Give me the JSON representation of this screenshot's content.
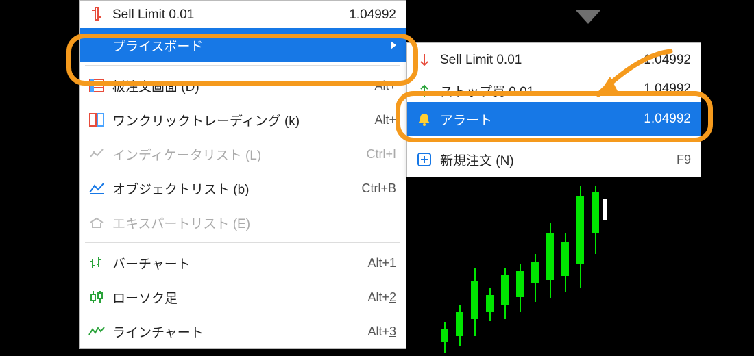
{
  "colors": {
    "highlight": "#1778e6",
    "ring": "#f59a1d",
    "candle": "#00e600"
  },
  "left_menu": {
    "sell_limit_label": "Sell Limit 0.01",
    "sell_limit_value": "1.04992",
    "priceboard": "プライスボード",
    "depth": "板注文画面 (D)",
    "depth_sc": "Alt+",
    "oneclick": "ワンクリックトレーディング (k)",
    "oneclick_sc": "Alt+",
    "indicator": "インディケータリスト (L)",
    "indicator_sc": "Ctrl+I",
    "object": "オブジェクトリスト (b)",
    "object_sc": "Ctrl+B",
    "expert": "エキスパートリスト (E)",
    "bar": "バーチャート",
    "bar_sc_pre": "Alt+",
    "bar_sc_u": "1",
    "candle": "ローソク足",
    "candle_sc_pre": "Alt+",
    "candle_sc_u": "2",
    "line": "ラインチャート",
    "line_sc_pre": "Alt+",
    "line_sc_u": "3"
  },
  "right_menu": {
    "sell_limit_label": "Sell Limit 0.01",
    "sell_limit_value": "1.04992",
    "stop_buy_label": "ストップ買 0.01",
    "stop_buy_value": "1.04992",
    "alert_label": "アラート",
    "alert_value": "1.04992",
    "neworder_label": "新規注文 (N)",
    "neworder_sc": "F9"
  }
}
